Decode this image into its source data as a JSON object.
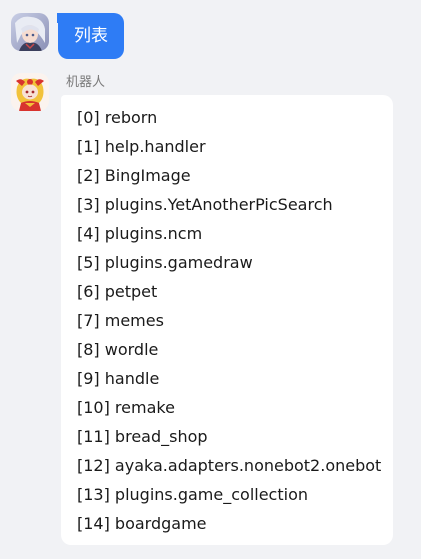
{
  "user_message": {
    "text": "列表",
    "bubble_color": "#2e7cf5"
  },
  "bot_message": {
    "sender_name": "机器人",
    "items": [
      "[0] reborn",
      "[1] help.handler",
      "[2] BingImage",
      "[3] plugins.YetAnotherPicSearch",
      "[4] plugins.ncm",
      "[5] plugins.gamedraw",
      "[6] petpet",
      "[7] memes",
      "[8] wordle",
      "[9] handle",
      "[10] remake",
      "[11] bread_shop",
      "[12] ayaka.adapters.nonebot2.onebot",
      "[13] plugins.game_collection",
      "[14] boardgame"
    ]
  },
  "colors": {
    "background": "#f1f2f5",
    "bot_bubble": "#ffffff",
    "text": "#1a1a1a",
    "sender_name": "#7a7a7a"
  },
  "icons": {
    "user_avatar": "user-avatar-image",
    "bot_avatar": "bot-avatar-image"
  }
}
